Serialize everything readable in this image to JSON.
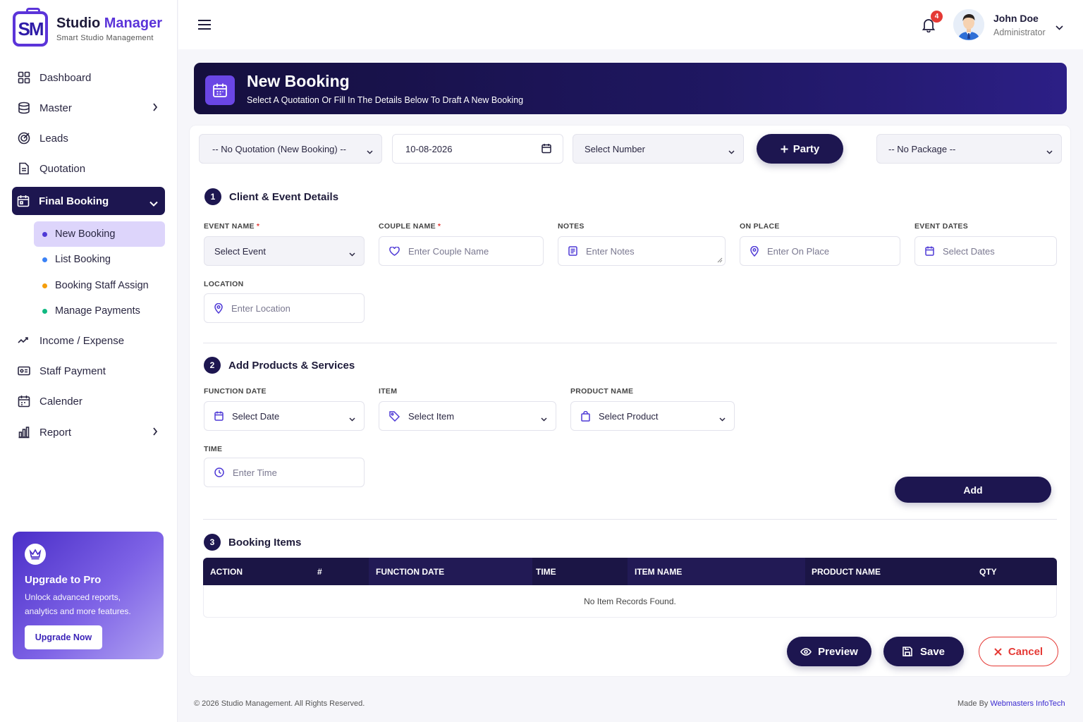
{
  "brand": {
    "title_main": "Studio ",
    "title_accent": "Manager",
    "subtitle": "Smart Studio Management",
    "logo_text": "SM"
  },
  "sidebar": {
    "items": [
      {
        "label": "Dashboard",
        "icon": "grid-icon"
      },
      {
        "label": "Master",
        "icon": "database-icon"
      },
      {
        "label": "Leads",
        "icon": "target-icon"
      },
      {
        "label": "Quotation",
        "icon": "document-icon"
      },
      {
        "label": "Final Booking",
        "icon": "calendar-icon"
      },
      {
        "label": "Income / Expense",
        "icon": "trend-icon"
      },
      {
        "label": "Staff Payment",
        "icon": "wallet-icon"
      },
      {
        "label": "Calender",
        "icon": "calendar-icon"
      },
      {
        "label": "Report",
        "icon": "chart-icon"
      }
    ],
    "sub_items": [
      {
        "label": "New Booking",
        "dot": "#4f3ad6"
      },
      {
        "label": "List Booking",
        "dot": "#3b82f6"
      },
      {
        "label": "Booking Staff Assign",
        "dot": "#f59e0b"
      },
      {
        "label": "Manage Payments",
        "dot": "#10b981"
      }
    ]
  },
  "promo": {
    "title": "Upgrade to Pro",
    "text": "Unlock advanced reports, analytics and more features.",
    "button": "Upgrade Now"
  },
  "topbar": {
    "notifications": "4",
    "user_name": "John Doe",
    "user_role": "Administrator"
  },
  "banner": {
    "title": "New Booking",
    "subtitle": "Select A Quotation Or Fill In The Details Below To Draft A New Booking"
  },
  "filters": {
    "quotation": "-- No Quotation (New Booking) --",
    "date": "10-08-2026",
    "number": "Select Number",
    "party_button": "Party",
    "package": "-- No Package --"
  },
  "section1": {
    "num": "1",
    "title": "Client & Event Details",
    "event_name_label": "EVENT NAME",
    "event_name_value": "Select Event",
    "couple_label": "COUPLE NAME",
    "couple_placeholder": "Enter Couple Name",
    "notes_label": "NOTES",
    "notes_placeholder": "Enter Notes",
    "onplace_label": "ON PLACE",
    "onplace_placeholder": "Enter On Place",
    "dates_label": "EVENT DATES",
    "dates_placeholder": "Select Dates",
    "location_label": "LOCATION",
    "location_placeholder": "Enter Location",
    "required_mark": "*"
  },
  "section2": {
    "num": "2",
    "title": "Add Products & Services",
    "function_date_label": "FUNCTION DATE",
    "function_date_value": "Select Date",
    "item_label": "ITEM",
    "item_value": "Select Item",
    "product_label": "PRODUCT NAME",
    "product_value": "Select Product",
    "time_label": "TIME",
    "time_placeholder": "Enter Time",
    "add_button": "Add"
  },
  "section3": {
    "num": "3",
    "title": "Booking Items",
    "columns": [
      "ACTION",
      "#",
      "FUNCTION DATE",
      "TIME",
      "ITEM NAME",
      "PRODUCT NAME",
      "QTY"
    ],
    "empty": "No Item Records Found."
  },
  "actions": {
    "preview": "Preview",
    "save": "Save",
    "cancel": "Cancel"
  },
  "footer": {
    "copyright": "© 2026 Studio Management. All Rights Reserved.",
    "made_by": "Made By ",
    "company": "Webmasters InfoTech"
  }
}
